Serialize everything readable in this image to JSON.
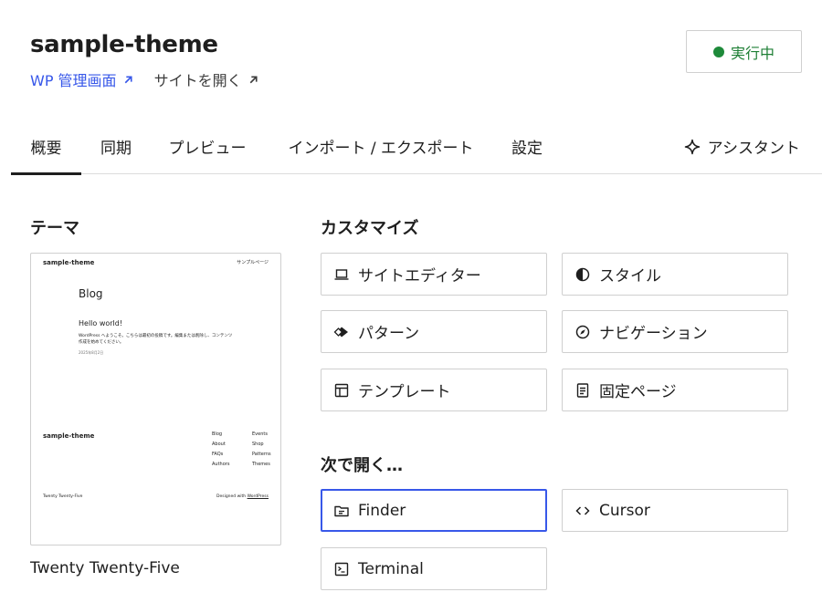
{
  "header": {
    "site_title": "sample-theme",
    "admin_link": "WP 管理画面",
    "open_site_link": "サイトを開く",
    "status_label": "実行中",
    "status_color": "#1e8a3a"
  },
  "tabs": {
    "items": [
      {
        "label": "概要",
        "active": true
      },
      {
        "label": "同期",
        "active": false
      },
      {
        "label": "プレビュー",
        "active": false
      },
      {
        "label": "インポート / エクスポート",
        "active": false
      },
      {
        "label": "設定",
        "active": false
      }
    ],
    "assistant_label": "アシスタント"
  },
  "theme": {
    "heading": "テーマ",
    "name": "Twenty Twenty-Five",
    "preview": {
      "site_title": "sample-theme",
      "nav_link": "サンプルページ",
      "blog_heading": "Blog",
      "post_title": "Hello world!",
      "post_excerpt_1": "WordPress へようこそ。こちらは最初の投稿です。編集または削除し、コンテンツ",
      "post_excerpt_2": "作成を始めてください。",
      "post_date": "2025年8月2日",
      "footer_title": "sample-theme",
      "footer_col1": [
        "Blog",
        "About",
        "FAQs",
        "Authors"
      ],
      "footer_col2": [
        "Events",
        "Shop",
        "Patterns",
        "Themes"
      ],
      "credit_left": "Twenty Twenty-Five",
      "credit_right_prefix": "Designed with ",
      "credit_right_link": "WordPress"
    }
  },
  "customize": {
    "heading": "カスタマイズ",
    "items": [
      {
        "label": "サイトエディター",
        "icon": "laptop-icon"
      },
      {
        "label": "スタイル",
        "icon": "styles-half-circle-icon"
      },
      {
        "label": "パターン",
        "icon": "patterns-diamond-icon"
      },
      {
        "label": "ナビゲーション",
        "icon": "compass-icon"
      },
      {
        "label": "テンプレート",
        "icon": "layout-icon"
      },
      {
        "label": "固定ページ",
        "icon": "page-icon"
      }
    ]
  },
  "open_in": {
    "heading": "次で開く…",
    "items": [
      {
        "label": "Finder",
        "icon": "folder-icon",
        "focused": true
      },
      {
        "label": "Cursor",
        "icon": "code-icon",
        "focused": false
      },
      {
        "label": "Terminal",
        "icon": "terminal-icon",
        "focused": false
      }
    ],
    "focus_color": "#3858e9"
  }
}
